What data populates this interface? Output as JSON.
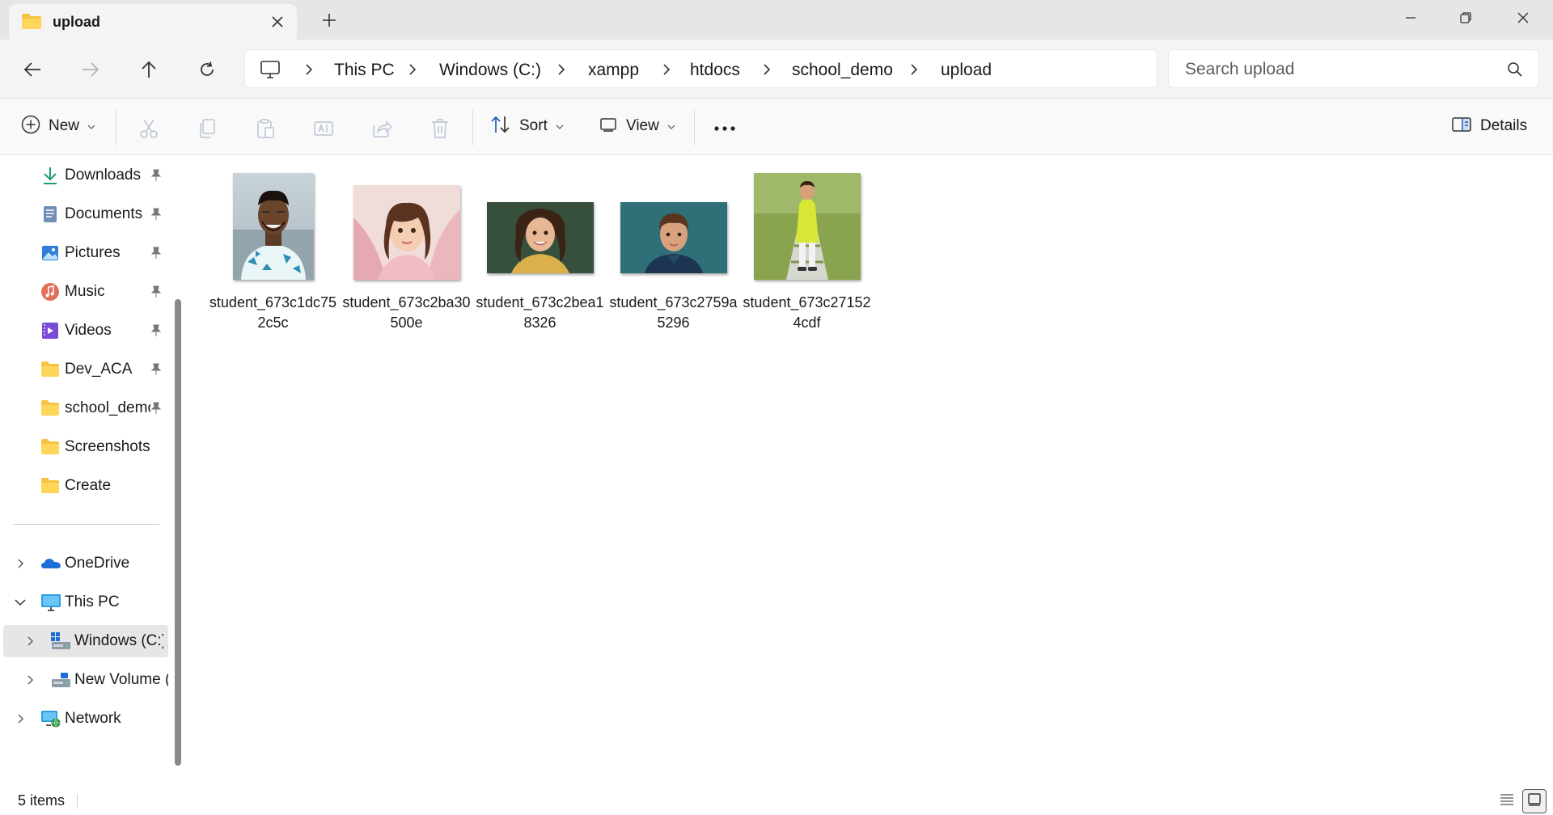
{
  "window": {
    "tab_title": "upload",
    "new_tab_symbol": "+"
  },
  "navigation": {
    "breadcrumbs": [
      "This PC",
      "Windows (C:)",
      "xampp",
      "htdocs",
      "school_demo",
      "upload"
    ],
    "search_placeholder": "Search upload"
  },
  "toolbar": {
    "new_label": "New",
    "sort_label": "Sort",
    "view_label": "View",
    "details_label": "Details"
  },
  "sidebar": {
    "quick_access": [
      {
        "label": "Downloads",
        "icon": "download-icon",
        "pinned": true
      },
      {
        "label": "Documents",
        "icon": "documents-icon",
        "pinned": true
      },
      {
        "label": "Pictures",
        "icon": "pictures-icon",
        "pinned": true
      },
      {
        "label": "Music",
        "icon": "music-icon",
        "pinned": true
      },
      {
        "label": "Videos",
        "icon": "videos-icon",
        "pinned": true
      },
      {
        "label": "Dev_ACA",
        "icon": "folder-icon",
        "pinned": true
      },
      {
        "label": "school_demo",
        "icon": "folder-icon",
        "pinned": true
      },
      {
        "label": "Screenshots",
        "icon": "folder-icon",
        "pinned": false
      },
      {
        "label": "Create",
        "icon": "folder-icon",
        "pinned": false
      }
    ],
    "tree": [
      {
        "label": "OneDrive",
        "icon": "onedrive-icon",
        "expanded": false
      },
      {
        "label": "This PC",
        "icon": "this-pc-icon",
        "expanded": true
      },
      {
        "label": "Windows (C:)",
        "icon": "drive-icon",
        "expanded": false,
        "selected": true
      },
      {
        "label": "New Volume (D:)",
        "icon": "drive-icon",
        "expanded": false
      },
      {
        "label": "Network",
        "icon": "network-icon",
        "expanded": false
      }
    ]
  },
  "files": [
    {
      "name": "student_673c1dc752c5c"
    },
    {
      "name": "student_673c2ba30500e"
    },
    {
      "name": "student_673c2bea18326"
    },
    {
      "name": "student_673c2759a5296"
    },
    {
      "name": "student_673c271524cdf"
    }
  ],
  "status": {
    "item_count": "5 items"
  },
  "colors": {
    "accent": "#0067c0",
    "folder": "#f6c342",
    "titlebar_bg": "#e6e6e6",
    "selected_bg": "#e6e6e6"
  }
}
